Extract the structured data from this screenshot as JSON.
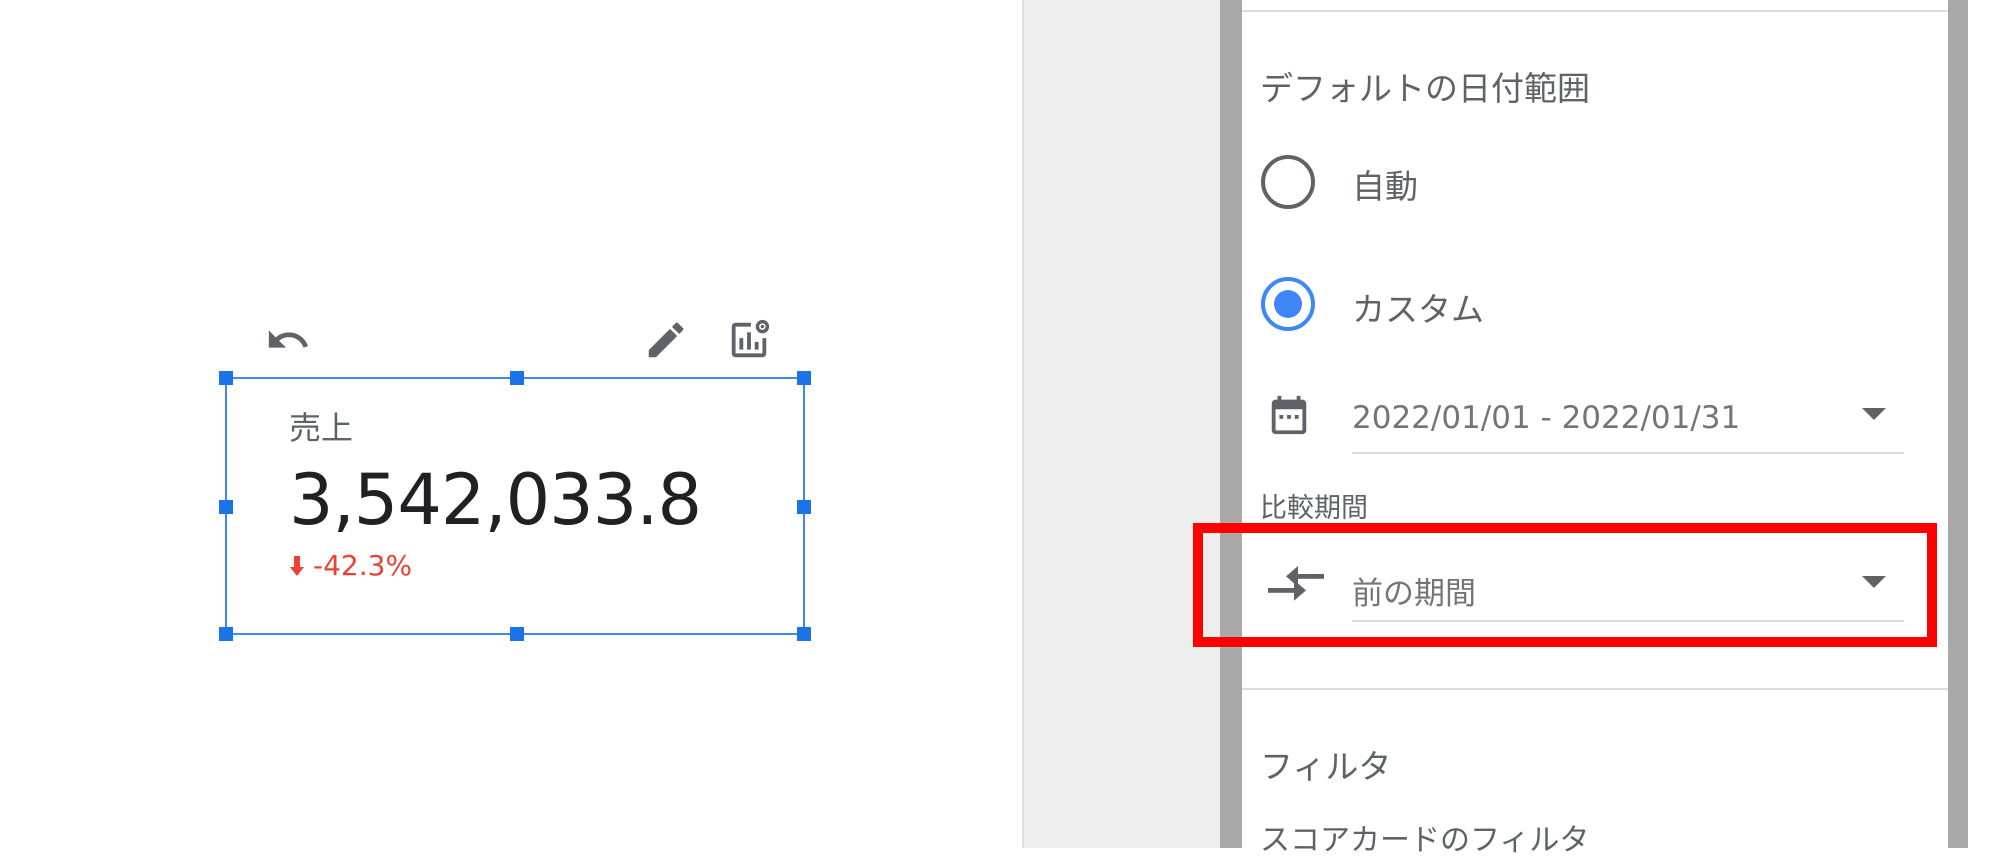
{
  "scorecard": {
    "metric_label": "売上",
    "value": "3,542,033.8",
    "delta": "-42.3%",
    "delta_icon": "arrow-down-icon"
  },
  "toolbar": {
    "undo_icon": "undo-icon",
    "edit_icon": "pencil-icon",
    "chart_settings_icon": "chart-settings-icon"
  },
  "panel": {
    "date_range_section_title": "デフォルトの日付範囲",
    "radio_auto_label": "自動",
    "radio_custom_label": "カスタム",
    "radio_selected": "カスタム",
    "date_range_value": "2022/01/01 - 2022/01/31",
    "comparison_label": "比較期間",
    "comparison_value": "前の期間",
    "filter_section_title": "フィルタ",
    "scorecard_filter_label": "スコアカードのフィルタ"
  },
  "colors": {
    "accent": "#4285f4",
    "negative": "#ea4335",
    "highlight": "#ff0000"
  }
}
